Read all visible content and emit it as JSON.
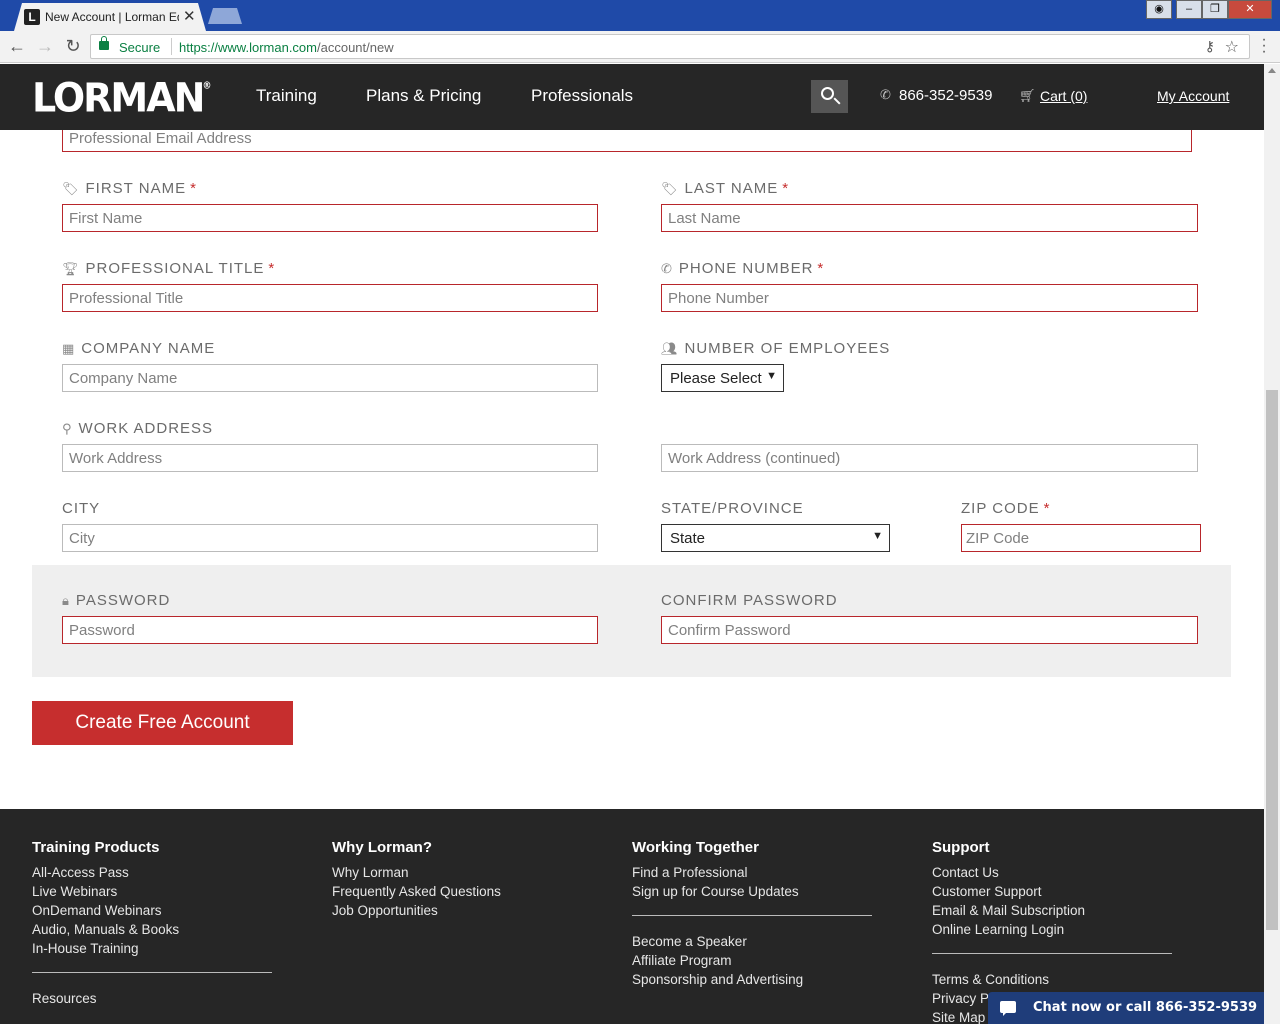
{
  "browser": {
    "tab_title": "New Account | Lorman Education Services",
    "tab_favicon": "L",
    "secure_label": "Secure",
    "url_origin": "https://www.lorman.com",
    "url_path": "/account/new"
  },
  "header": {
    "logo": "LORMAN",
    "logo_mark": "®",
    "nav": [
      "Training",
      "Plans & Pricing",
      "Professionals"
    ],
    "phone": "866-352-9539",
    "cart": "Cart (0)",
    "account": "My Account"
  },
  "form": {
    "email_placeholder": "Professional Email Address",
    "first_name": {
      "label": "First Name",
      "placeholder": "First Name"
    },
    "last_name": {
      "label": "Last Name",
      "placeholder": "Last Name"
    },
    "title": {
      "label": "Professional Title",
      "placeholder": "Professional Title"
    },
    "phone": {
      "label": "Phone Number",
      "placeholder": "Phone Number"
    },
    "company": {
      "label": "Company Name",
      "placeholder": "Company Name"
    },
    "employees": {
      "label": "Number of Employees",
      "value": "Please Select"
    },
    "address": {
      "label": "Work Address",
      "placeholder": "Work Address",
      "placeholder2": "Work Address (continued)"
    },
    "city": {
      "label": "City",
      "placeholder": "City"
    },
    "state": {
      "label": "State/Province",
      "value": "State"
    },
    "zip": {
      "label": "ZIP Code",
      "placeholder": "ZIP Code"
    },
    "password": {
      "label": "Password",
      "placeholder": "Password"
    },
    "confirm": {
      "label": "Confirm Password",
      "placeholder": "Confirm Password"
    },
    "required_mark": "*",
    "submit": "Create Free Account"
  },
  "footer": {
    "col1": {
      "head": "Training Products",
      "links": [
        "All-Access Pass",
        "Live Webinars",
        "OnDemand Webinars",
        "Audio, Manuals & Books",
        "In-House Training"
      ],
      "links2": [
        "Resources"
      ]
    },
    "col2": {
      "head": "Why Lorman?",
      "links": [
        "Why Lorman",
        "Frequently Asked Questions",
        "Job Opportunities"
      ]
    },
    "col3": {
      "head": "Working Together",
      "links": [
        "Find a Professional",
        "Sign up for Course Updates"
      ],
      "links2": [
        "Become a Speaker",
        "Affiliate Program",
        "Sponsorship and Advertising"
      ]
    },
    "col4": {
      "head": "Support",
      "links": [
        "Contact Us",
        "Customer Support",
        "Email & Mail Subscription",
        "Online Learning Login"
      ],
      "links2": [
        "Terms & Conditions",
        "Privacy Policy",
        "Site Map"
      ]
    }
  },
  "chat": {
    "label": "Chat now or call 866-352-9539"
  }
}
